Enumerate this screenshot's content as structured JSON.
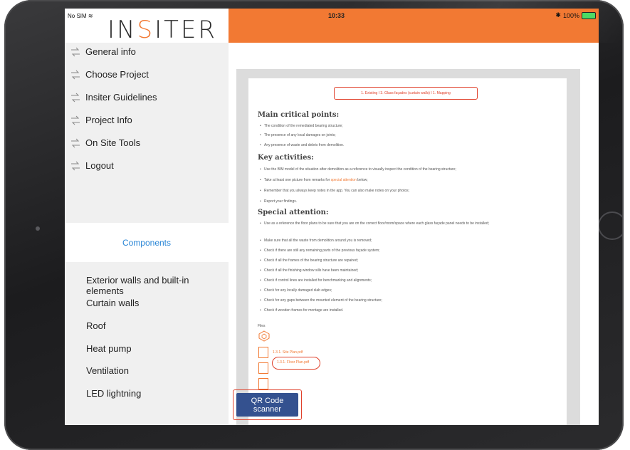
{
  "status": {
    "carrier": "No SIM",
    "time": "10:33",
    "battery": "100%"
  },
  "brand": {
    "logo_part1": "IN",
    "logo_accent": "S",
    "logo_part2": "ITER",
    "accent_color": "#f27933"
  },
  "sidebar": {
    "menu": [
      {
        "label": "General info",
        "icon": "sync-arrows-icon"
      },
      {
        "label": "Choose Project",
        "icon": "sync-arrows-icon"
      },
      {
        "label": "Insiter Guidelines",
        "icon": "sync-arrows-icon"
      },
      {
        "label": "Project Info",
        "icon": "sync-arrows-icon"
      },
      {
        "label": "On Site Tools",
        "icon": "sync-arrows-icon"
      },
      {
        "label": "Logout",
        "icon": "sync-arrows-icon"
      }
    ],
    "components_label": "Components",
    "components": [
      "Exterior walls and built-in elements",
      "Curtain walls",
      "Roof",
      "Heat pump",
      "Ventilation",
      "LED lightning"
    ]
  },
  "document": {
    "header": "1. Existing I 3. Glass façades (curtain walls) I 1. Mapping",
    "main_title": "Main critical points:",
    "main_points": [
      "The condition of the remediated bearing structure;",
      "The presence of any local damages on joints;",
      "Any presence of waste and debris from demolition."
    ],
    "key_title": "Key activities:",
    "key_points": [
      "Use the BIM model of the situation after demolition as a reference to visually inspect the condition of the bearing structure;",
      "Take at least one picture from remarks for ",
      "Remember that you always keep notes in the app. You can also make notes on your photos;",
      "Report your findings."
    ],
    "key_highlight": "special attention",
    "key_after": " below;",
    "special_title": "Special attention:",
    "special_points": [
      "Use as a reference the floor plans to be sure that you are on the correct floor/room/space where each glass façade panel needs to be installed;",
      "Make sure that all the waste from demolition around you is removed;",
      "Check if there are still any remaining parts of the previous façade system;",
      " Check if all the frames of the bearing structure are repaired;",
      "Check if all the finishing window sills have been maintained;",
      "Check if control lines are installed for benchmarking and alignments;",
      "Check for any locally damaged slab edges;",
      "Check for any gaps between the mounted element of the bearing structure;",
      "Check if wooden frames for montage are installed."
    ],
    "files_label": "Files",
    "files": [
      "1.3.1. Site Plan.pdf",
      "1.3.1. Floor Plan.pdf"
    ]
  },
  "qr_button": "QR Code scanner",
  "highlight_color": "#e0402a"
}
